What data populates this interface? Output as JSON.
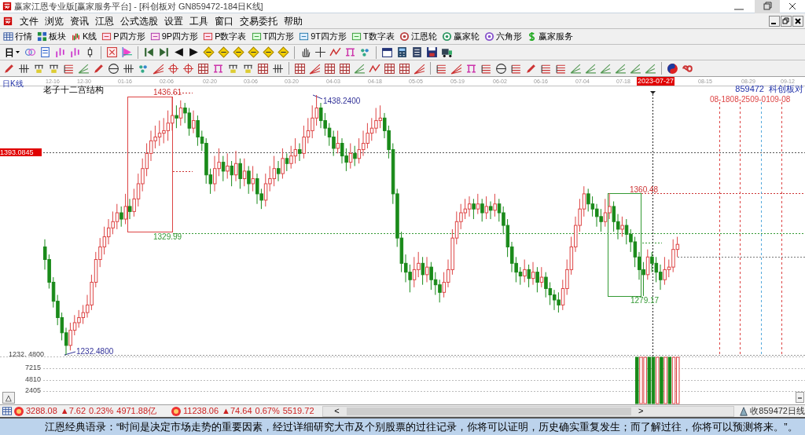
{
  "window": {
    "title": "赢家江恩专业版[赢家服务平台] - [科创板对  GN859472-184日K线]"
  },
  "menu": [
    "文件",
    "浏览",
    "资讯",
    "江恩",
    "公式选股",
    "设置",
    "工具",
    "窗口",
    "交易委托",
    "帮助"
  ],
  "toolbar": [
    "行情",
    "板块",
    "K线",
    "P四方形",
    "9P四方形",
    "P数字表",
    "T四方形",
    "9T四方形",
    "T数字表",
    "江恩轮",
    "赢家轮",
    "六角形",
    "赢家服务"
  ],
  "period_selector": {
    "label": "日"
  },
  "chart": {
    "period_label": "日K线",
    "indicator_title": "老子十二宫结构",
    "symbol": "859472",
    "symbol_name": "科创板对",
    "date_axis": [
      {
        "label": "12-16",
        "selected": false
      },
      {
        "label": "12-30",
        "selected": false
      },
      {
        "label": "01-16",
        "selected": false
      },
      {
        "label": "02-06",
        "selected": false
      },
      {
        "label": "02-20",
        "selected": false
      },
      {
        "label": "03-06",
        "selected": false
      },
      {
        "label": "03-20",
        "selected": false
      },
      {
        "label": "04-03",
        "selected": false
      },
      {
        "label": "04-18",
        "selected": false
      },
      {
        "label": "05-05",
        "selected": false
      },
      {
        "label": "05-19",
        "selected": false
      },
      {
        "label": "06-02",
        "selected": false
      },
      {
        "label": "06-16",
        "selected": false
      },
      {
        "label": "07-04",
        "selected": false
      },
      {
        "label": "07-18",
        "selected": false
      },
      {
        "label": "2023-07-27",
        "selected": true
      },
      {
        "label": "08-15",
        "selected": false
      },
      {
        "label": "08-29",
        "selected": false
      },
      {
        "label": "09-12",
        "selected": false
      }
    ],
    "price_tag": "1393.0845",
    "low_axis_label": "1232. 4800",
    "annotations": [
      "1436.61",
      "1329.99",
      "1438.2400",
      "1360.48",
      "1279.17",
      "1232.4800"
    ],
    "projection_dates": [
      "08-18",
      "08-25",
      "09-01",
      "09-08"
    ],
    "volume_axis": [
      "7215",
      "4810",
      "2405"
    ],
    "panel_toggle": "△",
    "chart_data": {
      "type": "candlestick",
      "ohlc": [
        [
          1318,
          1324,
          1300,
          1308
        ],
        [
          1308,
          1312,
          1285,
          1290
        ],
        [
          1290,
          1294,
          1270,
          1275
        ],
        [
          1275,
          1280,
          1256,
          1262
        ],
        [
          1262,
          1266,
          1244,
          1250
        ],
        [
          1250,
          1254,
          1232.48,
          1240
        ],
        [
          1240,
          1258,
          1236,
          1252
        ],
        [
          1252,
          1264,
          1248,
          1258
        ],
        [
          1258,
          1268,
          1254,
          1262
        ],
        [
          1262,
          1272,
          1257,
          1266
        ],
        [
          1266,
          1280,
          1262,
          1272
        ],
        [
          1272,
          1296,
          1268,
          1290
        ],
        [
          1290,
          1314,
          1286,
          1308
        ],
        [
          1308,
          1325,
          1302,
          1318
        ],
        [
          1318,
          1334,
          1312,
          1326
        ],
        [
          1326,
          1340,
          1320,
          1333
        ],
        [
          1333,
          1346,
          1328,
          1338
        ],
        [
          1338,
          1352,
          1332,
          1345
        ],
        [
          1345,
          1350,
          1334,
          1340
        ],
        [
          1340,
          1360,
          1336,
          1350
        ],
        [
          1350,
          1356,
          1340,
          1346
        ],
        [
          1346,
          1364,
          1342,
          1356
        ],
        [
          1356,
          1376,
          1350,
          1368
        ],
        [
          1368,
          1388,
          1362,
          1380
        ],
        [
          1380,
          1400,
          1374,
          1392
        ],
        [
          1392,
          1410,
          1386,
          1402
        ],
        [
          1402,
          1414,
          1396,
          1405
        ],
        [
          1405,
          1418,
          1398,
          1408
        ],
        [
          1408,
          1420,
          1400,
          1410
        ],
        [
          1410,
          1426,
          1402,
          1416
        ],
        [
          1416,
          1436.61,
          1410,
          1422
        ],
        [
          1422,
          1430,
          1412,
          1420
        ],
        [
          1420,
          1434,
          1414,
          1428
        ],
        [
          1428,
          1432,
          1416,
          1424
        ],
        [
          1424,
          1428,
          1406,
          1412
        ],
        [
          1412,
          1426,
          1408,
          1418
        ],
        [
          1418,
          1422,
          1398,
          1405
        ],
        [
          1405,
          1410,
          1394,
          1400
        ],
        [
          1400,
          1404,
          1368,
          1375
        ],
        [
          1375,
          1380,
          1360,
          1368
        ],
        [
          1368,
          1390,
          1362,
          1380
        ],
        [
          1380,
          1396,
          1374,
          1385
        ],
        [
          1385,
          1390,
          1370,
          1378
        ],
        [
          1378,
          1392,
          1372,
          1382
        ],
        [
          1382,
          1386,
          1366,
          1375
        ],
        [
          1375,
          1394,
          1370,
          1384
        ],
        [
          1384,
          1388,
          1364,
          1372
        ],
        [
          1372,
          1388,
          1366,
          1378
        ],
        [
          1378,
          1382,
          1360,
          1368
        ],
        [
          1368,
          1382,
          1362,
          1372
        ],
        [
          1372,
          1376,
          1352,
          1360
        ],
        [
          1360,
          1364,
          1348,
          1355
        ],
        [
          1355,
          1376,
          1350,
          1368
        ],
        [
          1368,
          1382,
          1362,
          1372
        ],
        [
          1372,
          1390,
          1366,
          1380
        ],
        [
          1380,
          1386,
          1370,
          1376
        ],
        [
          1376,
          1396,
          1372,
          1388
        ],
        [
          1388,
          1392,
          1378,
          1384
        ],
        [
          1384,
          1398,
          1380,
          1390
        ],
        [
          1390,
          1404,
          1384,
          1395
        ],
        [
          1395,
          1400,
          1386,
          1392
        ],
        [
          1392,
          1414,
          1388,
          1405
        ],
        [
          1405,
          1420,
          1400,
          1410
        ],
        [
          1410,
          1430,
          1404,
          1420
        ],
        [
          1420,
          1438.24,
          1414,
          1428
        ],
        [
          1428,
          1432,
          1412,
          1418
        ],
        [
          1418,
          1424,
          1406,
          1412
        ],
        [
          1412,
          1416,
          1398,
          1405
        ],
        [
          1405,
          1410,
          1390,
          1396
        ],
        [
          1396,
          1410,
          1392,
          1400
        ],
        [
          1400,
          1404,
          1384,
          1390
        ],
        [
          1390,
          1396,
          1378,
          1385
        ],
        [
          1385,
          1400,
          1380,
          1392
        ],
        [
          1392,
          1398,
          1382,
          1388
        ],
        [
          1388,
          1404,
          1384,
          1395
        ],
        [
          1395,
          1410,
          1390,
          1400
        ],
        [
          1400,
          1416,
          1396,
          1408
        ],
        [
          1408,
          1420,
          1402,
          1412
        ],
        [
          1412,
          1428,
          1408,
          1418
        ],
        [
          1418,
          1430,
          1412,
          1420
        ],
        [
          1420,
          1424,
          1404,
          1410
        ],
        [
          1410,
          1414,
          1388,
          1395
        ],
        [
          1395,
          1400,
          1352,
          1360
        ],
        [
          1360,
          1364,
          1318,
          1325
        ],
        [
          1325,
          1330,
          1298,
          1305
        ],
        [
          1305,
          1312,
          1290,
          1298
        ],
        [
          1298,
          1304,
          1282,
          1292
        ],
        [
          1292,
          1310,
          1286,
          1300
        ],
        [
          1300,
          1314,
          1294,
          1305
        ],
        [
          1305,
          1310,
          1288,
          1296
        ],
        [
          1296,
          1310,
          1290,
          1302
        ],
        [
          1302,
          1306,
          1284,
          1292
        ],
        [
          1292,
          1298,
          1280,
          1288
        ],
        [
          1288,
          1292,
          1274,
          1282
        ],
        [
          1282,
          1298,
          1278,
          1290
        ],
        [
          1290,
          1308,
          1286,
          1300
        ],
        [
          1300,
          1332,
          1296,
          1325
        ],
        [
          1325,
          1346,
          1320,
          1338
        ],
        [
          1338,
          1352,
          1332,
          1345
        ],
        [
          1345,
          1356,
          1340,
          1348
        ],
        [
          1348,
          1358,
          1342,
          1352
        ],
        [
          1352,
          1356,
          1340,
          1348
        ],
        [
          1348,
          1360,
          1344,
          1352
        ],
        [
          1352,
          1356,
          1338,
          1345
        ],
        [
          1345,
          1358,
          1340,
          1350
        ],
        [
          1350,
          1354,
          1340,
          1347
        ],
        [
          1347,
          1360,
          1342,
          1352
        ],
        [
          1352,
          1356,
          1338,
          1345
        ],
        [
          1345,
          1350,
          1328,
          1335
        ],
        [
          1335,
          1340,
          1310,
          1318
        ],
        [
          1318,
          1322,
          1298,
          1305
        ],
        [
          1305,
          1310,
          1290,
          1298
        ],
        [
          1298,
          1302,
          1288,
          1295
        ],
        [
          1295,
          1308,
          1290,
          1300
        ],
        [
          1300,
          1304,
          1286,
          1293
        ],
        [
          1293,
          1306,
          1288,
          1298
        ],
        [
          1298,
          1302,
          1282,
          1290
        ],
        [
          1290,
          1302,
          1286,
          1294
        ],
        [
          1294,
          1298,
          1278,
          1285
        ],
        [
          1285,
          1290,
          1272,
          1280
        ],
        [
          1280,
          1284,
          1268,
          1276
        ],
        [
          1276,
          1282,
          1266,
          1272
        ],
        [
          1272,
          1292,
          1268,
          1285
        ],
        [
          1285,
          1308,
          1280,
          1300
        ],
        [
          1300,
          1326,
          1296,
          1318
        ],
        [
          1318,
          1342,
          1314,
          1335
        ],
        [
          1335,
          1356,
          1330,
          1348
        ],
        [
          1348,
          1366,
          1342,
          1360
        ],
        [
          1360,
          1364,
          1346,
          1352
        ],
        [
          1352,
          1358,
          1342,
          1348
        ],
        [
          1348,
          1352,
          1334,
          1342
        ],
        [
          1342,
          1348,
          1330,
          1338
        ],
        [
          1338,
          1356,
          1334,
          1345
        ],
        [
          1345,
          1360.48,
          1340,
          1350
        ],
        [
          1350,
          1354,
          1330,
          1338
        ],
        [
          1338,
          1344,
          1324,
          1332
        ],
        [
          1332,
          1342,
          1326,
          1335
        ],
        [
          1335,
          1340,
          1320,
          1328
        ],
        [
          1328,
          1332,
          1314,
          1322
        ],
        [
          1322,
          1326,
          1302,
          1310
        ],
        [
          1310,
          1314,
          1292,
          1300
        ],
        [
          1300,
          1306,
          1279.17,
          1296
        ],
        [
          1296,
          1316,
          1292,
          1310
        ],
        [
          1310,
          1314,
          1298,
          1305
        ],
        [
          1305,
          1310,
          1290,
          1298
        ],
        [
          1298,
          1304,
          1284,
          1292
        ],
        [
          1292,
          1310,
          1288,
          1300
        ],
        [
          1300,
          1308,
          1294,
          1302
        ],
        [
          1302,
          1324,
          1298,
          1316
        ],
        [
          1316,
          1326,
          1310,
          1320
        ]
      ]
    }
  },
  "status_bar": {
    "indices": [
      {
        "value": "3288.08",
        "change": "▲7.62",
        "percent": "0.23%",
        "turnover": "4971.88亿"
      },
      {
        "value": "11238.06",
        "change": "▲74.64",
        "percent": "0.67%",
        "turnover": "5519.72"
      }
    ],
    "scroll_left": "<",
    "scroll_right": ">",
    "right_label": "收859472日线"
  },
  "quote": "江恩经典语录：“时间是决定市场走势的重要因素，经过详细研究大市及个别股票的过往记录，你将可以证明，历史确实重复发生；而了解过往，你将可以预测将来。”。"
}
